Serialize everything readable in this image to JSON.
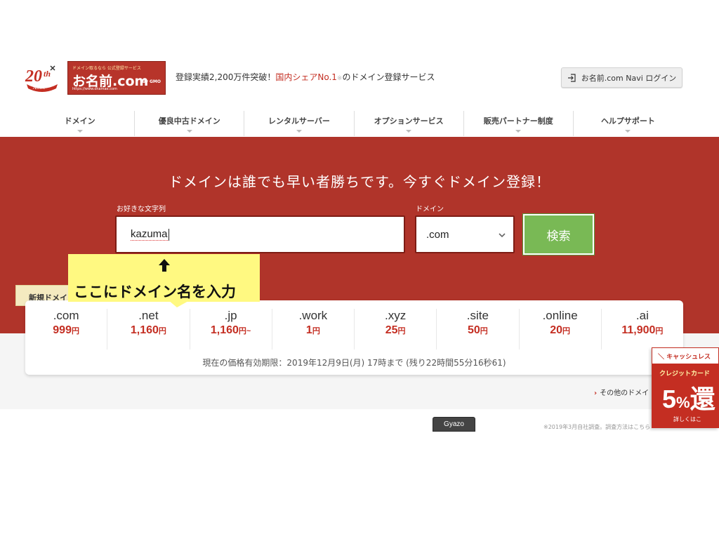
{
  "header": {
    "anniversary_badge": "20th Anniv.",
    "logo": {
      "tagline": "ドメイン取るなら 公式登録サービス",
      "name": "お名前.com",
      "url": "https://www.onamae.com",
      "gmo": "by GMO"
    },
    "tagline_prefix": "登録実績2,200万件突破！",
    "tagline_highlight": "国内シェアNo.1",
    "tagline_note": "※",
    "tagline_suffix": "のドメイン登録サービス",
    "login_label": "お名前.com Navi ログイン"
  },
  "nav": {
    "items": [
      {
        "label": "ドメイン"
      },
      {
        "label": "優良中古ドメイン"
      },
      {
        "label": "レンタルサーバー"
      },
      {
        "label": "オプションサービス"
      },
      {
        "label": "販売パートナー制度"
      },
      {
        "label": "ヘルプサポート"
      }
    ]
  },
  "hero": {
    "title": "ドメインは誰でも早い者勝ちです。今すぐドメイン登録！",
    "string_label": "お好きな文字列",
    "string_value": "kazuma",
    "domain_label": "ドメイン",
    "domain_selected": ".com",
    "search_label": "検索"
  },
  "annotation": {
    "arrow": "⬆",
    "text": "ここにドメイン名を入力"
  },
  "new_domain_tab": "新規ドメイ",
  "prices": {
    "items": [
      {
        "tld": ".com",
        "price": "999",
        "yen": "円"
      },
      {
        "tld": ".net",
        "price": "1,160",
        "yen": "円"
      },
      {
        "tld": ".jp",
        "price": "1,160",
        "yen": "円~"
      },
      {
        "tld": ".work",
        "price": "1",
        "yen": "円"
      },
      {
        "tld": ".xyz",
        "price": "25",
        "yen": "円"
      },
      {
        "tld": ".site",
        "price": "50",
        "yen": "円"
      },
      {
        "tld": ".online",
        "price": "20",
        "yen": "円"
      },
      {
        "tld": ".ai",
        "price": "11,900",
        "yen": "円"
      }
    ],
    "validity": "現在の価格有効期限：2019年12月9日(月) 17時まで (残り22時間55分16秒61)"
  },
  "other_link": "その他のドメイ",
  "footnote": "※2019年3月自社調査。調査方法はこちら",
  "cashless": {
    "header": "＼ キャッシュレス",
    "sub": "クレジットカード",
    "big": "5",
    "pct": "%",
    "big_suffix": "還",
    "more": "詳しくはこ"
  },
  "gyazo_label": "Gyazo",
  "colors": {
    "brand_red": "#b0342a",
    "price_red": "#c42e22",
    "search_green": "#79b955",
    "callout_yellow": "#fff981"
  }
}
